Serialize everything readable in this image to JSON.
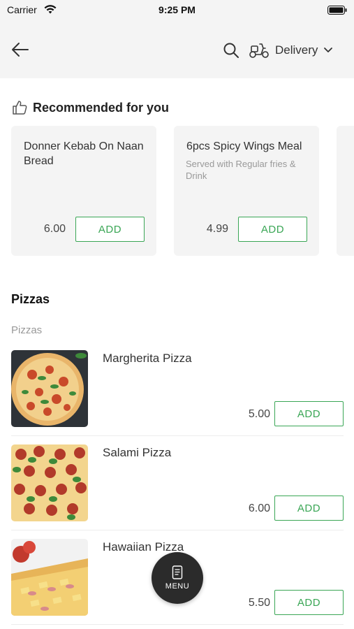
{
  "status_bar": {
    "carrier": "Carrier",
    "time": "9:25 PM"
  },
  "header": {
    "back_icon": "arrow-left-icon",
    "search_icon": "search-icon",
    "delivery_icon": "scooter-icon",
    "delivery_label": "Delivery",
    "dropdown_icon": "chevron-down-icon"
  },
  "recommended": {
    "title": "Recommended for you",
    "icon": "thumbs-up-icon",
    "items": [
      {
        "name": "Donner Kebab On Naan Bread",
        "description": "",
        "price": "6.00",
        "add_label": "ADD"
      },
      {
        "name": "6pcs Spicy Wings Meal",
        "description": "Served with Regular fries & Drink",
        "price": "4.99",
        "add_label": "ADD"
      }
    ]
  },
  "menu_section": {
    "title": "Pizzas",
    "subtitle": "Pizzas",
    "items": [
      {
        "name": "Margherita Pizza",
        "price": "5.00",
        "add_label": "ADD"
      },
      {
        "name": "Salami Pizza",
        "price": "6.00",
        "add_label": "ADD"
      },
      {
        "name": "Hawaiian Pizza",
        "price": "5.50",
        "add_label": "ADD"
      }
    ]
  },
  "menu_button": {
    "label": "MENU",
    "icon": "menu-book-icon"
  },
  "colors": {
    "accent": "#3aa655",
    "header_bg": "#f4f4f4",
    "card_bg": "#f4f4f4",
    "fab_bg": "#2b2b2b"
  }
}
